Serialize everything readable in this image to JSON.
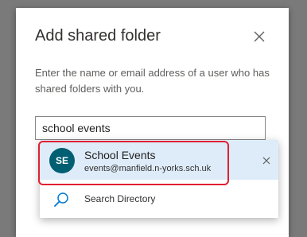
{
  "dialog": {
    "title": "Add shared folder",
    "description": "Enter the name or email address of a user who has shared folders with you.",
    "input_value": "school events"
  },
  "suggestions": [
    {
      "initials": "SE",
      "name": "School Events",
      "email": "events@manfield.n-yorks.sch.uk",
      "avatar_color": "#005f73"
    }
  ],
  "search_directory_label": "Search Directory",
  "colors": {
    "highlight_border": "#e02030",
    "suggestion_bg": "#deecf9",
    "accent": "#0078d4"
  },
  "icons": {
    "close": "close-icon",
    "remove": "close-icon",
    "search": "search-icon"
  }
}
